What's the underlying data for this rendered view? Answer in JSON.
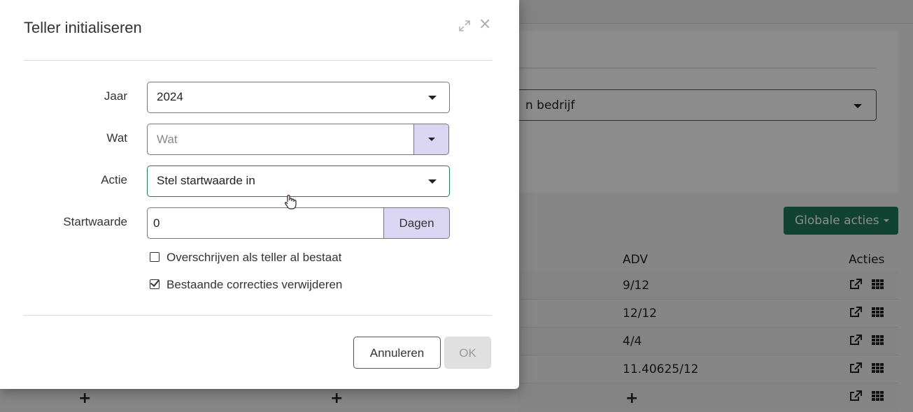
{
  "background": {
    "company_select_text": "n bedrijf",
    "global_actions_label": "Globale acties",
    "table": {
      "headers": {
        "adv": "ADV",
        "actions": "Acties"
      },
      "rows": [
        {
          "adv": "9/12"
        },
        {
          "adv": "12/12"
        },
        {
          "adv": "4/4"
        },
        {
          "adv": "11.40625/12"
        }
      ],
      "add_symbol": "+"
    }
  },
  "modal": {
    "title": "Teller initialiseren",
    "close_symbol": "×",
    "fields": {
      "jaar": {
        "label": "Jaar",
        "value": "2024"
      },
      "wat": {
        "label": "Wat",
        "placeholder": "Wat",
        "value": ""
      },
      "actie": {
        "label": "Actie",
        "value": "Stel startwaarde in"
      },
      "startwaarde": {
        "label": "Startwaarde",
        "value": "0",
        "unit": "Dagen"
      }
    },
    "checkboxes": {
      "overwrite": {
        "label": "Overschrijven als teller al bestaat",
        "checked": false
      },
      "delete_corrections": {
        "label": "Bestaande correcties verwijderen",
        "checked": true
      }
    },
    "buttons": {
      "cancel": "Annuleren",
      "ok": "OK"
    }
  },
  "colors": {
    "accent_green": "#1e7a5a",
    "addon_purple": "#dcd6f5",
    "disabled_button": "#e0e0e0"
  }
}
